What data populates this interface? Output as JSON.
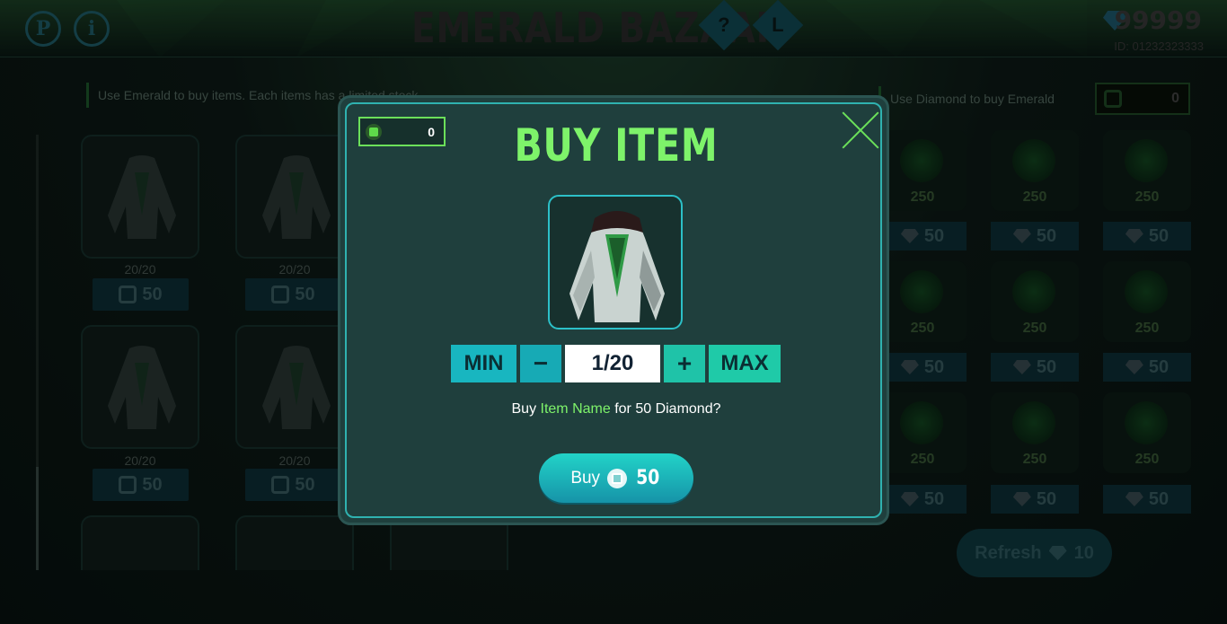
{
  "header": {
    "title": "EMERALD BAZAAR",
    "left_icons": [
      "P",
      "i"
    ],
    "help_icon": "?",
    "leaderboard_icon": "L",
    "diamond_balance": "99999",
    "player_id": "ID: 01232323333"
  },
  "left_panel": {
    "hint": "Use Emerald to buy items. Each items has a limited stock",
    "items": [
      {
        "stock": "20/20",
        "price": "50"
      },
      {
        "stock": "20/20",
        "price": "50"
      },
      {
        "stock": "20/20",
        "price": "50"
      },
      {
        "stock": "20/20",
        "price": "50"
      }
    ]
  },
  "right_panel": {
    "hint": "Use Diamond to buy Emerald",
    "emerald_count": "0",
    "packs": [
      {
        "amount": "250",
        "price": "50"
      },
      {
        "amount": "250",
        "price": "50"
      },
      {
        "amount": "250",
        "price": "50"
      },
      {
        "amount": "250",
        "price": "50"
      },
      {
        "amount": "250",
        "price": "50"
      },
      {
        "amount": "250",
        "price": "50"
      },
      {
        "amount": "250",
        "price": "50"
      },
      {
        "amount": "250",
        "price": "50"
      },
      {
        "amount": "250",
        "price": "50"
      }
    ],
    "refresh_label": "Refresh",
    "refresh_cost": "10"
  },
  "modal": {
    "title": "BUY ITEM",
    "emerald_count": "0",
    "min_label": "MIN",
    "minus_label": "−",
    "quantity": "1/20",
    "plus_label": "+",
    "max_label": "MAX",
    "confirm_prefix": "Buy ",
    "item_name": "Item Name",
    "confirm_suffix": " for 50 Diamond?",
    "buy_label": "Buy",
    "buy_amount": "50"
  },
  "colors": {
    "accent_green": "#7ef36a",
    "accent_cyan": "#18b6c0",
    "modal_bg": "#1f3f3d"
  }
}
